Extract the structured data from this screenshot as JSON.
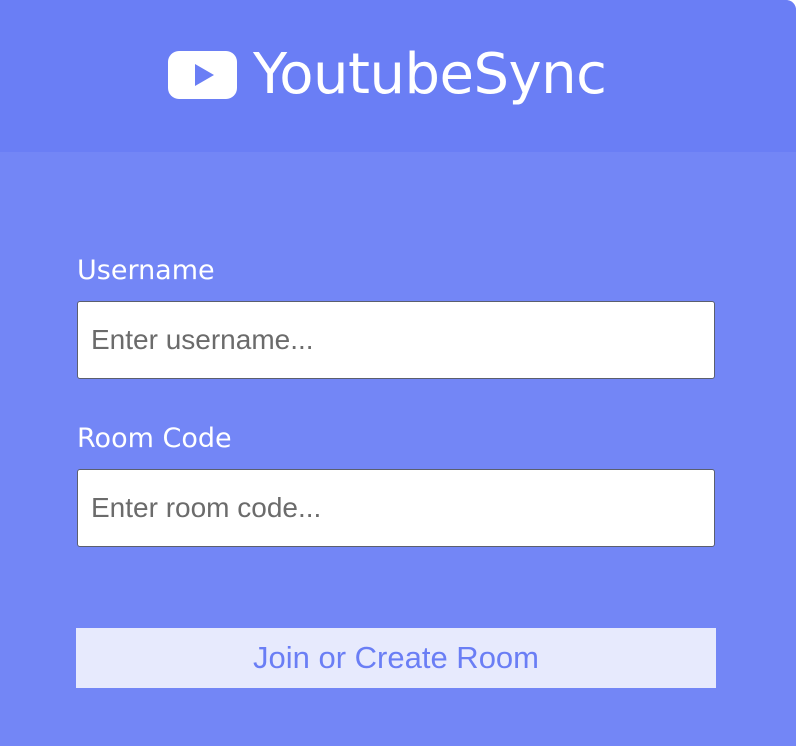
{
  "header": {
    "logo_icon": "youtube-play-icon",
    "title": "YoutubeSync"
  },
  "form": {
    "username": {
      "label": "Username",
      "value": "",
      "placeholder": "Enter username..."
    },
    "room_code": {
      "label": "Room Code",
      "value": "",
      "placeholder": "Enter room code..."
    },
    "submit_label": "Join or Create Room"
  },
  "colors": {
    "header_background": "#6a7ef5",
    "body_background": "#7386f6",
    "button_background": "#e7eafd",
    "button_text": "#6a7ef5",
    "label_text": "#ffffff"
  }
}
